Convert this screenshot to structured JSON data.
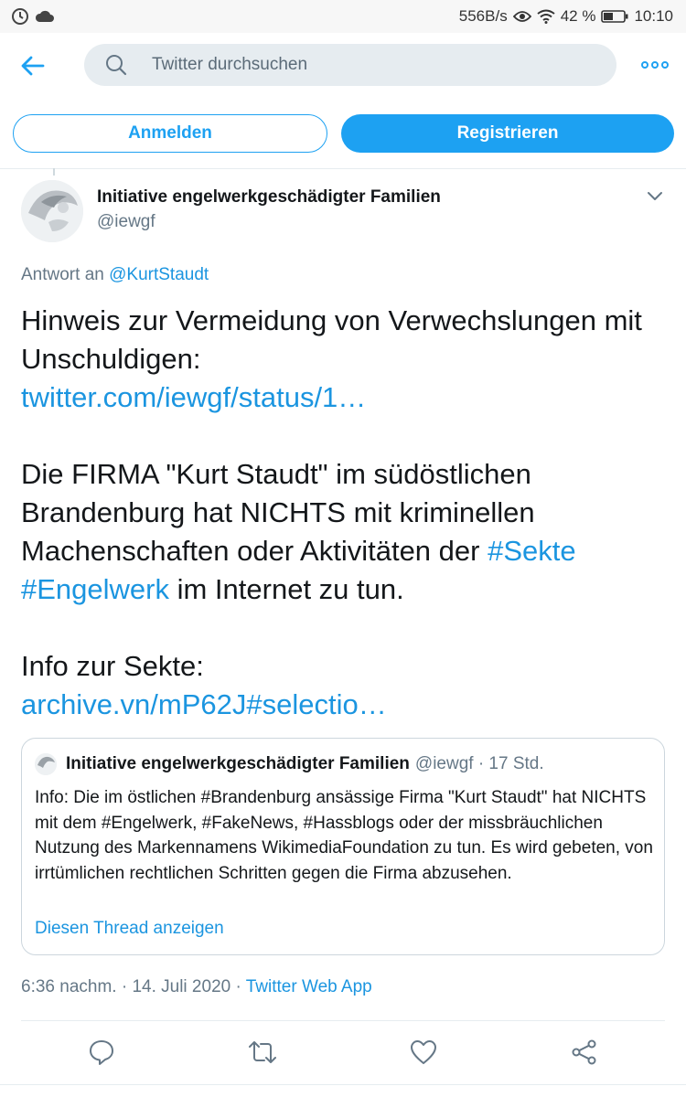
{
  "status_bar": {
    "network_speed": "556B/s",
    "battery": "42 %",
    "time": "10:10"
  },
  "search": {
    "placeholder": "Twitter durchsuchen"
  },
  "auth": {
    "login_label": "Anmelden",
    "register_label": "Registrieren"
  },
  "tweet": {
    "author_name": "Initiative engelwerkgeschädigter Familien",
    "author_handle": "@iewgf",
    "reply_prefix": "Antwort an",
    "reply_to": "@KurtStaudt",
    "line1": "Hinweis zur Vermeidung von Verwechslungen mit Unschuldigen:",
    "link1": "twitter.com/iewgf/status/1…",
    "para2_part1": "Die FIRMA \"Kurt Staudt\" im südöstlichen Brandenburg hat NICHTS mit kriminellen Machenschaften oder Aktivitäten der",
    "hashtag1": "#Sekte",
    "hashtag2": "#Engelwerk",
    "para2_part2": "im Internet zu tun.",
    "info_label": "Info zur Sekte:",
    "link2": "archive.vn/mP62J#selectio…",
    "timestamp": "6:36 nachm. · 14. Juli 2020 ·",
    "source_app": "Twitter Web App"
  },
  "quote": {
    "author_name": "Initiative engelwerkgeschädigter Familien",
    "meta": "@iewgf · 17 Std.",
    "text": "Info: Die im östlichen #Brandenburg ansässige Firma \"Kurt Staudt\" hat NICHTS mit dem #Engelwerk, #FakeNews, #Hassblogs oder der missbräuchlichen Nutzung des Markennamens WikimediaFoundation zu tun. Es wird gebeten, von irrtümlichen rechtlichen Schritten gegen die Firma abzusehen.",
    "thread_link": "Diesen Thread anzeigen"
  },
  "colors": {
    "accent": "#1da1f2",
    "link": "#1b95e0",
    "secondary_text": "#657786"
  },
  "icons": [
    "back-arrow-icon",
    "search-icon",
    "more-icon",
    "chevron-down-icon",
    "reply-icon",
    "retweet-icon",
    "like-icon",
    "share-icon"
  ]
}
